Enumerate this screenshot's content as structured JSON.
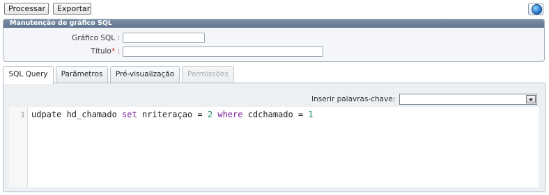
{
  "toolbar": {
    "processar_label": "Processar",
    "exportar_label": "Exportar"
  },
  "panel": {
    "title": "Manutenção de gráfico SQL",
    "grafico_label": "Gráfico SQL :",
    "grafico_value": "",
    "titulo_label": "Título",
    "titulo_required": "*",
    "titulo_colon": " :",
    "titulo_value": ""
  },
  "tabs": [
    {
      "label": "SQL Query",
      "active": true
    },
    {
      "label": "Parâmetros"
    },
    {
      "label": "Pré-visualização"
    },
    {
      "label": "Permissões",
      "disabled": true
    }
  ],
  "query": {
    "keywords_label": "Inserir palavras-chave:",
    "keywords_selected": "",
    "line_number": "1",
    "tokens": {
      "t1": "udpate hd_chamado ",
      "t2": "set",
      "t3": " nriteraçao = ",
      "t4": "2",
      "t5": " ",
      "t6": "where",
      "t7": " cdchamado = ",
      "t8": "1"
    }
  },
  "icons": {
    "globe": "globe-icon",
    "dropdown": "chevron-down-icon"
  }
}
